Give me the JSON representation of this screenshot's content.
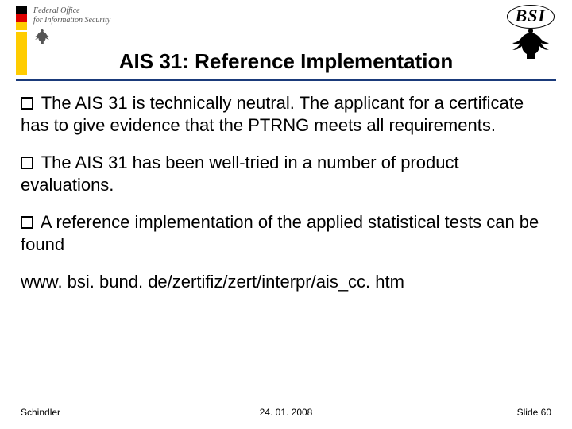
{
  "header": {
    "agency_line1": "Federal Office",
    "agency_line2": "for Information Security",
    "bsi_label": "BSI"
  },
  "title": "AIS 31: Reference Implementation",
  "bullets": [
    "The AIS 31 is technically neutral. The applicant for a certificate has to give evidence that the PTRNG meets all requirements.",
    "The AIS 31 has been well-tried in a number of product evaluations.",
    "A reference implementation of the applied statistical tests can be found"
  ],
  "url": "www. bsi. bund. de/zertifiz/zert/interpr/ais_cc. htm",
  "footer": {
    "author": "Schindler",
    "date": "24. 01. 2008",
    "slide": "Slide 60"
  }
}
